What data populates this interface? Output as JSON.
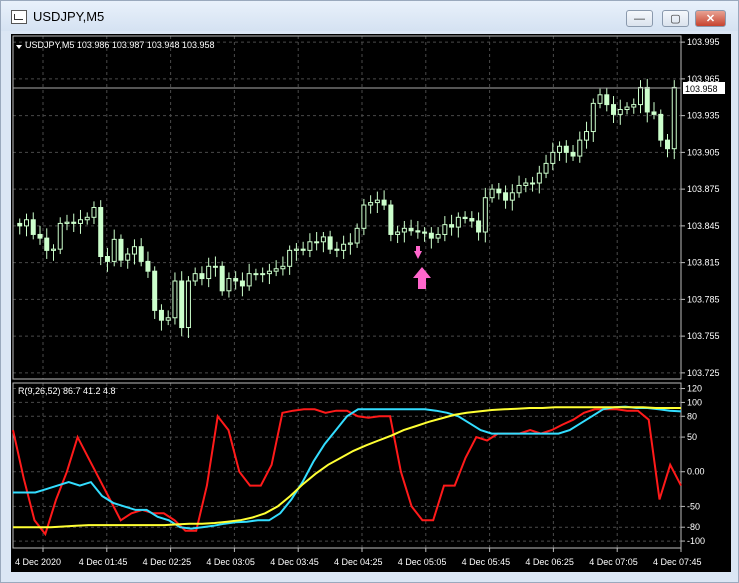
{
  "window": {
    "title": "USDJPY,M5",
    "buttons": {
      "minimize": "—",
      "maximize": "▢",
      "close": "✕"
    }
  },
  "colors": {
    "background": "#000000",
    "grid": "#4a4a4a",
    "candle": "#ccffcc",
    "series_red": "#ff1a1a",
    "series_cyan": "#33ddff",
    "series_yellow": "#ffff33",
    "marker": "#ff66cc"
  },
  "chart_data": [
    {
      "type": "candlestick",
      "title": "USDJPY,M5  103.986 103.987 103.948 103.958",
      "symbol": "USDJPY,M5",
      "ohlc_header": [
        "103.986",
        "103.987",
        "103.948",
        "103.958"
      ],
      "last_price": "103.958",
      "y_ticks": [
        "103.995",
        "103.965",
        "103.935",
        "103.905",
        "103.875",
        "103.845",
        "103.815",
        "103.785",
        "103.755",
        "103.725"
      ],
      "ylim": [
        103.72,
        104.0
      ],
      "close": [
        103.845,
        103.85,
        103.838,
        103.835,
        103.825,
        103.826,
        103.847,
        103.848,
        103.847,
        103.85,
        103.852,
        103.86,
        103.82,
        103.816,
        103.834,
        103.817,
        103.822,
        103.828,
        103.816,
        103.808,
        103.776,
        103.768,
        103.77,
        103.8,
        103.762,
        103.8,
        103.806,
        103.802,
        103.812,
        103.812,
        103.792,
        103.802,
        103.8,
        103.796,
        103.806,
        103.806,
        103.806,
        103.808,
        103.81,
        103.812,
        103.825,
        103.826,
        103.825,
        103.832,
        103.832,
        103.836,
        103.826,
        103.825,
        103.83,
        103.831,
        103.843,
        103.862,
        103.864,
        103.866,
        103.862,
        103.838,
        103.84,
        103.843,
        103.841,
        103.84,
        103.839,
        103.835,
        103.838,
        103.846,
        103.844,
        103.852,
        103.851,
        103.849,
        103.84,
        103.868,
        103.875,
        103.872,
        103.866,
        103.872,
        103.878,
        103.88,
        103.88,
        103.888,
        103.896,
        103.905,
        103.91,
        103.905,
        103.902,
        103.915,
        103.922,
        103.945,
        103.952,
        103.944,
        103.936,
        103.94,
        103.942,
        103.944,
        103.958,
        103.938,
        103.936,
        103.915,
        103.908,
        103.958
      ]
    },
    {
      "type": "line",
      "title": "R(9,26,52) 86.7 41.2 4.8",
      "y_ticks": [
        "120",
        "100",
        "80",
        "50",
        "0.00",
        "-50",
        "-80",
        "-100"
      ],
      "ylim": [
        -110,
        128
      ],
      "x_ticks": [
        "4 Dec 2020",
        "4 Dec 01:45",
        "4 Dec 02:25",
        "4 Dec 03:05",
        "4 Dec 03:45",
        "4 Dec 04:25",
        "4 Dec 05:05",
        "4 Dec 05:45",
        "4 Dec 06:25",
        "4 Dec 07:05",
        "4 Dec 07:45"
      ],
      "series": [
        {
          "color": "#ff1a1a",
          "values": [
            60,
            -10,
            -70,
            -90,
            -40,
            0,
            50,
            20,
            -10,
            -40,
            -70,
            -60,
            -55,
            -60,
            -60,
            -70,
            -85,
            -85,
            -20,
            80,
            60,
            0,
            -20,
            -20,
            10,
            85,
            88,
            90,
            90,
            85,
            88,
            88,
            80,
            78,
            80,
            80,
            0,
            -50,
            -70,
            -70,
            -20,
            -20,
            20,
            50,
            45,
            55,
            55,
            55,
            60,
            55,
            60,
            68,
            75,
            85,
            90,
            90,
            90,
            88,
            88,
            75,
            -40,
            10,
            -20
          ]
        },
        {
          "color": "#33ddff",
          "values": [
            -30,
            -30,
            -30,
            -25,
            -20,
            -15,
            -20,
            -15,
            -35,
            -45,
            -50,
            -55,
            -55,
            -65,
            -70,
            -80,
            -82,
            -80,
            -78,
            -75,
            -73,
            -72,
            -70,
            -70,
            -60,
            -40,
            -15,
            15,
            40,
            60,
            80,
            90,
            90,
            90,
            90,
            90,
            90,
            90,
            88,
            85,
            80,
            70,
            60,
            55,
            55,
            55,
            55,
            55,
            55,
            55,
            60,
            70,
            80,
            90,
            93,
            94,
            92,
            92,
            90,
            88,
            87
          ]
        },
        {
          "color": "#ffff33",
          "values": [
            -80,
            -80,
            -80,
            -80,
            -79,
            -78,
            -77,
            -77,
            -77,
            -77,
            -77,
            -77,
            -77,
            -76,
            -75,
            -75,
            -74,
            -72,
            -70,
            -66,
            -60,
            -50,
            -35,
            -18,
            -3,
            10,
            20,
            30,
            38,
            45,
            52,
            60,
            66,
            72,
            77,
            82,
            85,
            87,
            89,
            90,
            91,
            92,
            92,
            93,
            93,
            93,
            93,
            93,
            93,
            93,
            93,
            92,
            92,
            92
          ]
        }
      ]
    }
  ]
}
